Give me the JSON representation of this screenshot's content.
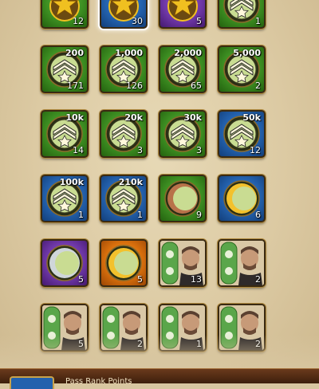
{
  "colors": {
    "green": "#3d8f22",
    "blue": "#2361ad",
    "purple": "#6f38a8",
    "orange": "#d9700d",
    "bronze": "#b8724a",
    "silver": "#cfd6da",
    "gold": "#f3c12c",
    "medal_inner": "#c9dc92",
    "star": "#f0c020"
  },
  "tiles": [
    {
      "bg": "green",
      "icon": "star-medal-icon",
      "cost": "",
      "count": "12"
    },
    {
      "bg": "blue",
      "icon": "star-medal-icon",
      "cost": "",
      "count": "30",
      "selected": true
    },
    {
      "bg": "purple",
      "icon": "star-medal-icon",
      "cost": "",
      "count": "5"
    },
    {
      "bg": "green",
      "icon": "chevron-rank-icon",
      "cost": "",
      "count": "1"
    },
    {
      "bg": "green",
      "icon": "chevron-rank-icon",
      "cost": "200",
      "count": "171"
    },
    {
      "bg": "green",
      "icon": "chevron-rank-icon",
      "cost": "1,000",
      "count": "126"
    },
    {
      "bg": "green",
      "icon": "chevron-rank-icon",
      "cost": "2,000",
      "count": "65"
    },
    {
      "bg": "green",
      "icon": "chevron-rank-icon",
      "cost": "5,000",
      "count": "2"
    },
    {
      "bg": "green",
      "icon": "chevron-rank-icon",
      "cost": "10k",
      "count": "14"
    },
    {
      "bg": "green",
      "icon": "chevron-rank-icon",
      "cost": "20k",
      "count": "3"
    },
    {
      "bg": "green",
      "icon": "chevron-rank-icon",
      "cost": "30k",
      "count": "3"
    },
    {
      "bg": "blue",
      "icon": "chevron-rank-icon",
      "cost": "50k",
      "count": "12"
    },
    {
      "bg": "blue",
      "icon": "chevron-rank-icon",
      "cost": "100k",
      "count": "1"
    },
    {
      "bg": "blue",
      "icon": "chevron-rank-icon",
      "cost": "210k",
      "count": "1"
    },
    {
      "bg": "green",
      "icon": "bronze-medal-icon",
      "cost": "",
      "count": "9"
    },
    {
      "bg": "blue",
      "icon": "gold-medal-icon",
      "cost": "",
      "count": "6"
    },
    {
      "bg": "purple",
      "icon": "silver-medal-icon",
      "cost": "",
      "count": "5"
    },
    {
      "bg": "orange",
      "icon": "gold-medal-icon",
      "cost": "",
      "count": "5"
    },
    {
      "bg": "portrait",
      "icon": "general-portrait-icon",
      "cost": "",
      "count": "13"
    },
    {
      "bg": "portrait",
      "icon": "general-portrait-icon",
      "cost": "",
      "count": "2"
    },
    {
      "bg": "portrait",
      "icon": "general-portrait-icon",
      "cost": "",
      "count": "5"
    },
    {
      "bg": "portrait",
      "icon": "general-portrait-icon",
      "cost": "",
      "count": "2"
    },
    {
      "bg": "portrait",
      "icon": "general-portrait-icon",
      "cost": "",
      "count": "1"
    },
    {
      "bg": "portrait",
      "icon": "general-portrait-icon",
      "cost": "",
      "count": "2"
    }
  ],
  "bottom_bar": {
    "label": "Pass Rank Points"
  }
}
